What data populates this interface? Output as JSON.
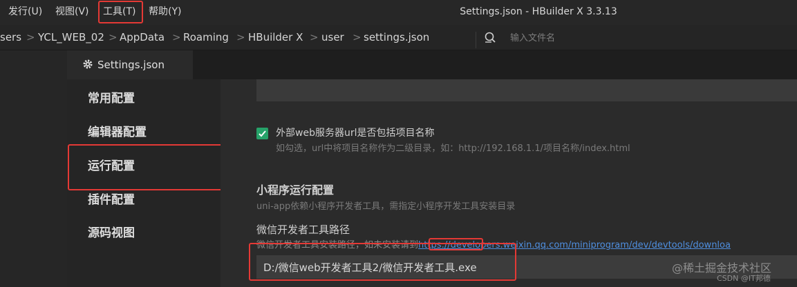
{
  "menubar": {
    "items": [
      "发行(U)",
      "视图(V)",
      "工具(T)",
      "帮助(Y)"
    ],
    "window_title": "Settings.json - HBuilder X 3.3.13"
  },
  "breadcrumb": {
    "items": [
      "sers",
      "YCL_WEB_02",
      "AppData",
      "Roaming",
      "HBuilder X",
      "user",
      "settings.json"
    ],
    "separator": ">"
  },
  "search": {
    "placeholder": "输入文件名"
  },
  "tab": {
    "label": "Settings.json"
  },
  "sidebar": {
    "items": [
      "常用配置",
      "编辑器配置",
      "运行配置",
      "插件配置",
      "源码视图"
    ]
  },
  "settings": {
    "external_server": {
      "checked": true,
      "label": "外部web服务器url是否包括项目名称",
      "hint": "如勾选，url中将项目名称作为二级目录，如：http://192.168.1.1/项目名称/index.html"
    },
    "miniprogram_section": {
      "title": "小程序运行配置",
      "subtitle": "uni-app依赖小程序开发者工具，需指定小程序开发工具安装目录"
    },
    "wechat_path": {
      "label": "微信开发者工具路径",
      "desc_prefix": "微信开发者工具安装路径，如未安装请到",
      "link": "https://developers.weixin.qq.com/miniprogram/dev/devtools/downloa",
      "value": "D:/微信web开发者工具2/微信开发者工具.exe"
    }
  },
  "watermark": {
    "line1": "@稀土掘金技术社区",
    "line2": "CSDN @IT邦德"
  },
  "colors": {
    "highlight": "#e53935",
    "checkbox": "#26a269",
    "link": "#4f8fe0"
  }
}
